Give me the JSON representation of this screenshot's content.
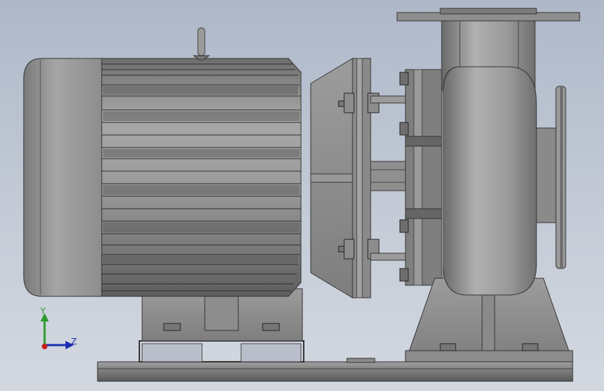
{
  "app": {
    "title": ""
  },
  "model": {
    "name": ""
  },
  "triad": {
    "x_label": "",
    "y_label": "Y",
    "z_label": "Z"
  },
  "colors": {
    "background_top": "#aeb8c8",
    "background_bottom": "#d3d8e0",
    "metal_light": "#b8b8b8",
    "metal_mid": "#8f8f8f",
    "metal_dark": "#5a5a5a",
    "axis_y": "#2d9a2d",
    "axis_z": "#1a2db0",
    "axis_x": "#c81e1e"
  }
}
